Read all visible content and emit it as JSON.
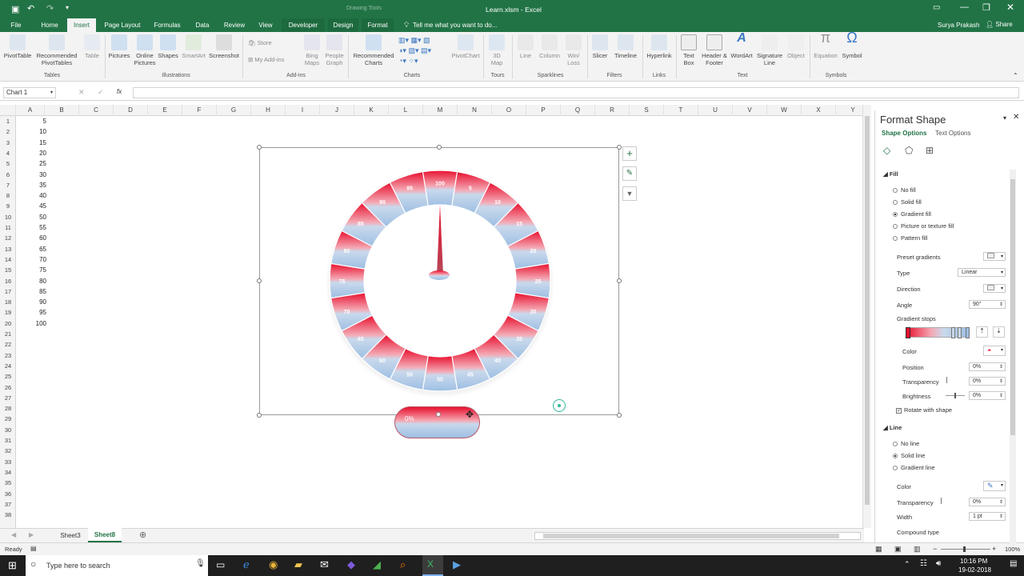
{
  "window": {
    "title": "Learn.xlsm - Excel",
    "context_tab": "Drawing Tools",
    "user": "Surya Prakash",
    "share": "Share"
  },
  "tabs": [
    "File",
    "Home",
    "Insert",
    "Page Layout",
    "Formulas",
    "Data",
    "Review",
    "View",
    "Developer",
    "Design",
    "Format"
  ],
  "tell_me": "Tell me what you want to do...",
  "ribbon": {
    "buttons": [
      "PivotTable",
      "Recommended PivotTables",
      "Table",
      "Pictures",
      "Online Pictures",
      "Shapes",
      "SmartArt",
      "Screenshot",
      "Store",
      "My Add-ins",
      "Bing Maps",
      "People Graph",
      "Recommended Charts",
      "PivotChart",
      "3D Map",
      "Line",
      "Column",
      "Win/ Loss",
      "Slicer",
      "Timeline",
      "Hyperlink",
      "Text Box",
      "Header & Footer",
      "WordArt",
      "Signature Line",
      "Object",
      "Equation",
      "Symbol"
    ],
    "groups": [
      "Tables",
      "Illustrations",
      "Add-ins",
      "Charts",
      "Tours",
      "Sparklines",
      "Filters",
      "Links",
      "Text",
      "Symbols"
    ]
  },
  "formula_bar": {
    "name_box": "Chart 1",
    "fx": "fx",
    "value": ""
  },
  "columns": [
    "A",
    "B",
    "C",
    "D",
    "E",
    "F",
    "G",
    "H",
    "I",
    "J",
    "K",
    "L",
    "M",
    "N",
    "O",
    "P",
    "Q",
    "R",
    "S",
    "T",
    "U",
    "V",
    "W",
    "X",
    "Y"
  ],
  "rows": [
    "1",
    "2",
    "3",
    "4",
    "5",
    "6",
    "7",
    "8",
    "9",
    "10",
    "11",
    "12",
    "13",
    "14",
    "15",
    "16",
    "17",
    "18",
    "19",
    "20",
    "21",
    "22",
    "23",
    "24",
    "25",
    "26",
    "27",
    "28",
    "29",
    "30",
    "31",
    "32",
    "33",
    "34",
    "35",
    "36",
    "37",
    "38"
  ],
  "col_a_values": [
    "5",
    "10",
    "15",
    "20",
    "25",
    "30",
    "35",
    "40",
    "45",
    "50",
    "55",
    "60",
    "65",
    "70",
    "75",
    "80",
    "85",
    "90",
    "95",
    "100"
  ],
  "gauge": {
    "labels": [
      "100",
      "5",
      "10",
      "15",
      "20",
      "25",
      "30",
      "35",
      "40",
      "45",
      "50",
      "55",
      "60",
      "65",
      "70",
      "75",
      "80",
      "85",
      "90",
      "95"
    ],
    "percent_label": "0%",
    "value": 0
  },
  "sheets": [
    "Sheet3",
    "Sheet8"
  ],
  "status": {
    "ready": "Ready",
    "zoom": "100%"
  },
  "taskbar": {
    "search": "Type here to search",
    "time": "10:16 PM",
    "date": "19-02-2018"
  },
  "pane": {
    "title": "Format Shape",
    "tab1": "Shape Options",
    "tab2": "Text Options",
    "fill_header": "Fill",
    "fill_options": [
      "No fill",
      "Solid fill",
      "Gradient fill",
      "Picture or texture fill",
      "Pattern fill"
    ],
    "preset": "Preset gradients",
    "type_label": "Type",
    "type_value": "Linear",
    "direction": "Direction",
    "angle_label": "Angle",
    "angle_value": "90°",
    "stops": "Gradient stops",
    "color": "Color",
    "position_label": "Position",
    "position_value": "0%",
    "transparency_label": "Transparency",
    "transparency_value": "0%",
    "brightness_label": "Brightness",
    "brightness_value": "0%",
    "rotate": "Rotate with shape",
    "line_header": "Line",
    "line_options": [
      "No line",
      "Solid line",
      "Gradient line"
    ],
    "line_color": "Color",
    "line_transparency": "Transparency",
    "line_transparency_value": "0%",
    "width_label": "Width",
    "width_value": "1 pt",
    "compound": "Compound type"
  },
  "colors": {
    "excel_green": "#217346",
    "gauge_red": "#e8102e",
    "gauge_blue": "#a9c8e6"
  }
}
